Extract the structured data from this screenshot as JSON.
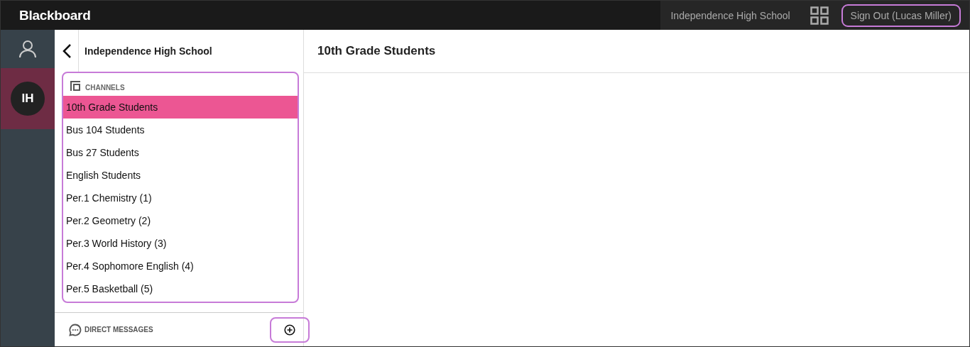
{
  "topbar": {
    "logo": "Blackboard",
    "school": "Independence High School",
    "sign_out": "Sign Out (Lucas Miller)"
  },
  "rail": {
    "items": [
      {
        "kind": "profile",
        "selected": false
      },
      {
        "kind": "org",
        "label": "IH",
        "selected": true
      }
    ]
  },
  "panel": {
    "title": "Independence High School",
    "channels_heading": "CHANNELS",
    "channels": [
      {
        "label": "10th Grade Students",
        "selected": true
      },
      {
        "label": "Bus 104 Students",
        "selected": false
      },
      {
        "label": "Bus 27 Students",
        "selected": false
      },
      {
        "label": "English Students",
        "selected": false
      },
      {
        "label": "Per.1 Chemistry (1)",
        "selected": false
      },
      {
        "label": "Per.2 Geometry (2)",
        "selected": false
      },
      {
        "label": "Per.3 World History (3)",
        "selected": false
      },
      {
        "label": "Per.4 Sophomore English (4)",
        "selected": false
      },
      {
        "label": "Per.5 Basketball (5)",
        "selected": false
      }
    ],
    "dm_heading": "DIRECT MESSAGES"
  },
  "main": {
    "title": "10th Grade Students"
  }
}
